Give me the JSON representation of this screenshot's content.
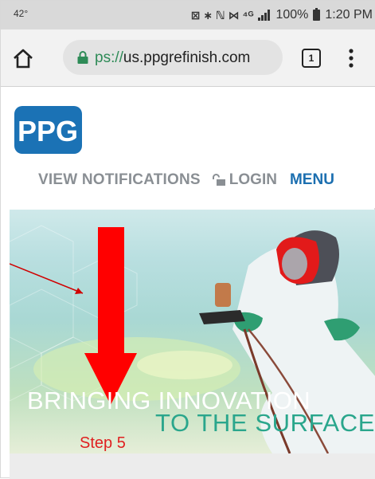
{
  "status_bar": {
    "temperature": "42°",
    "symbols": "⊠ ∗ ℕ ⋈ ⁴ᴳ",
    "battery": "100%",
    "time": "1:20 PM"
  },
  "browser": {
    "url_scheme": "ps://",
    "url_host": "us.ppgrefinish.com",
    "tab_count": "1"
  },
  "site": {
    "logo_text": "PPG",
    "nav": {
      "notifications": "VIEW NOTIFICATIONS",
      "login": "LOGIN",
      "menu": "MENU"
    }
  },
  "hero": {
    "headline": "BRINGING INNOVATION",
    "subheadline": "TO THE SURFACE"
  },
  "annotation": {
    "step_label": "Step 5",
    "arrow_color": "#ff0000",
    "pointer_color": "#d00000"
  },
  "colors": {
    "brand_blue": "#1b72b5",
    "menu_blue": "#1c6fb0",
    "nav_gray": "#8a8f94",
    "secure_green": "#2e8b57",
    "subheadline_teal": "#2aa68c"
  }
}
